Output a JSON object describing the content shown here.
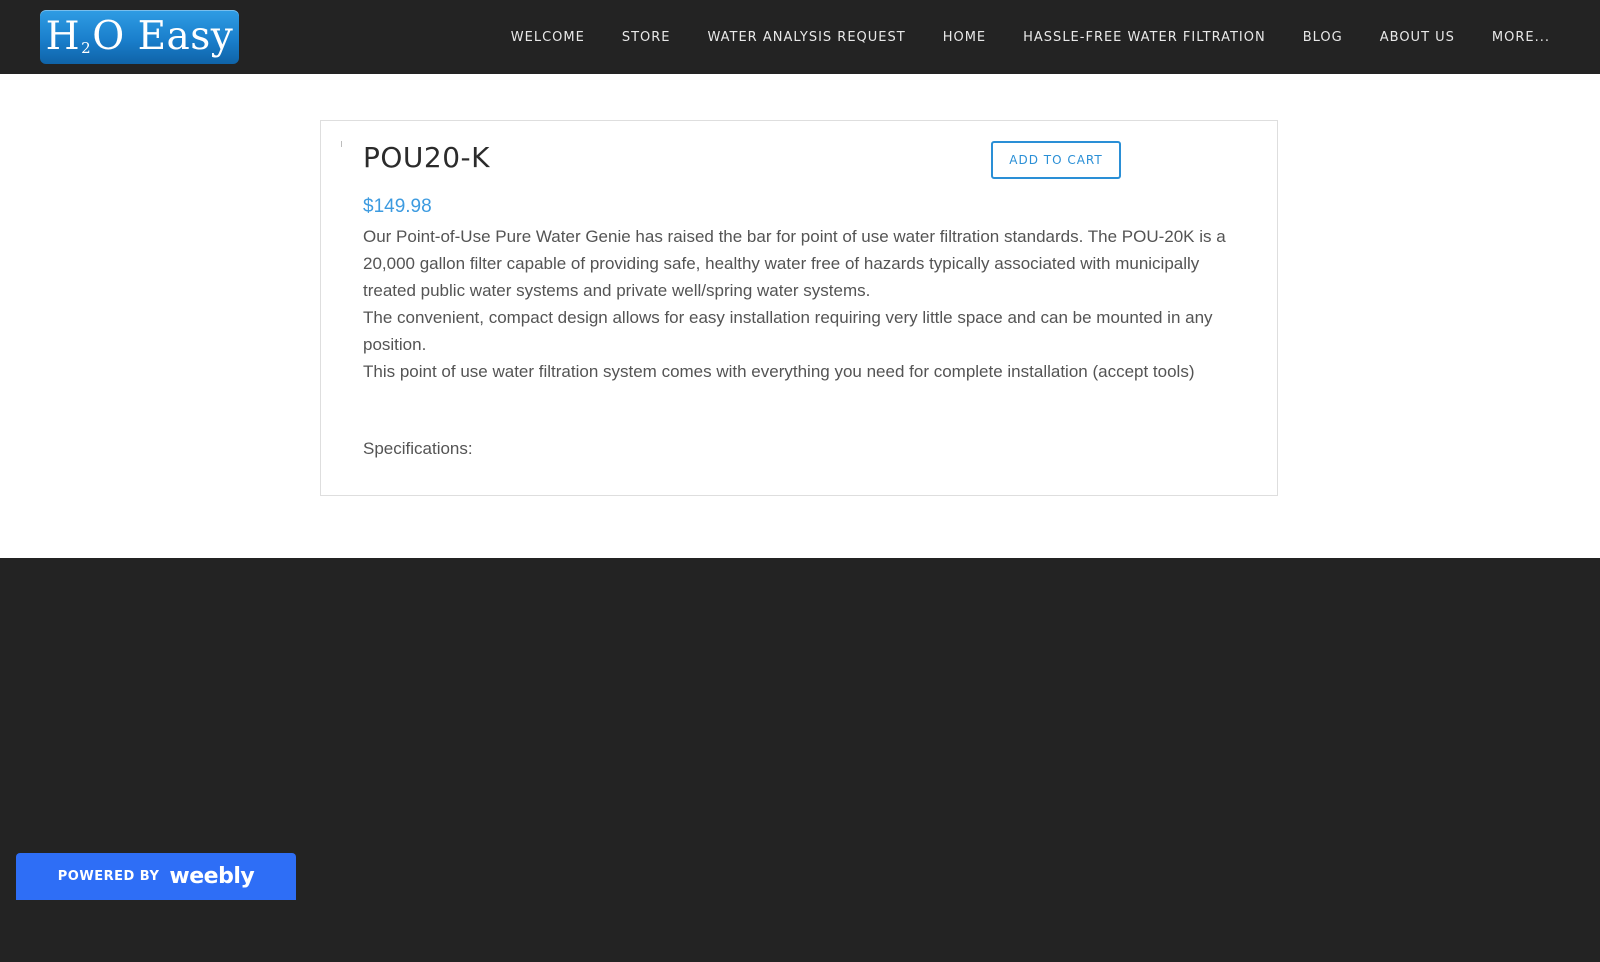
{
  "header": {
    "logo": {
      "text_before": "H",
      "subscript": "2",
      "text_after": "O Easy"
    },
    "nav": [
      {
        "label": "WELCOME"
      },
      {
        "label": "STORE"
      },
      {
        "label": "WATER ANALYSIS REQUEST"
      },
      {
        "label": "HOME"
      },
      {
        "label": "HASSLE-FREE WATER FILTRATION"
      },
      {
        "label": "BLOG"
      },
      {
        "label": "ABOUT US"
      },
      {
        "label": "MORE..."
      }
    ]
  },
  "product": {
    "title": "POU20-K",
    "add_to_cart_label": "ADD TO CART",
    "price": "$149.98",
    "description": [
      "Our Point-of-Use Pure Water Genie has raised the bar for point of use water filtration standards. The POU-20K is a 20,000 gallon filter capable of providing safe, healthy water free of hazards typically associated with municipally treated public water systems and private well/spring water systems.",
      "The convenient, compact design allows for easy installation requiring very little space and can be mounted in any position.",
      "This point of use water filtration system comes with everything you need for complete installation (accept tools)"
    ],
    "specs_label": "Specifications:"
  },
  "footer": {
    "badge": {
      "powered_by": "POWERED BY",
      "brand": "weebly"
    }
  },
  "colors": {
    "header_bg": "#232323",
    "accent": "#2a8fd6",
    "price": "#3d9be0",
    "badge_bg": "#2e6ef6"
  }
}
